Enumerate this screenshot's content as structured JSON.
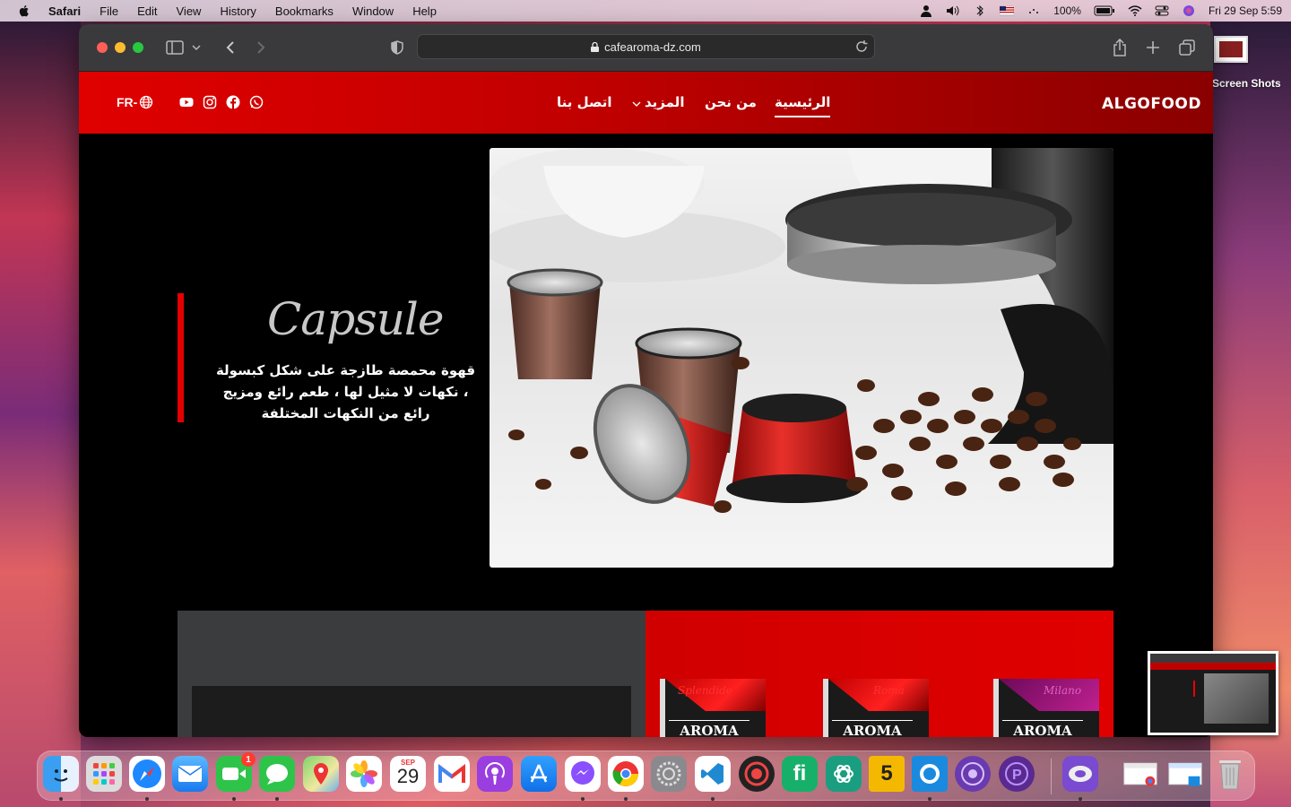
{
  "menubar": {
    "app_name": "Safari",
    "items": [
      "File",
      "Edit",
      "View",
      "History",
      "Bookmarks",
      "Window",
      "Help"
    ],
    "battery": "100%",
    "datetime": "Fri 29 Sep  5:59"
  },
  "desktop": {
    "item_label": "Screen Shots"
  },
  "browser": {
    "url": "cafearoma-dz.com"
  },
  "site": {
    "logo": "ALGOFOOD",
    "nav": {
      "home": "الرئيسية",
      "about": "من نحن",
      "more": "المزيد",
      "contact": "اتصل بنا"
    },
    "lang": "FR-",
    "hero": {
      "title": "Capsule",
      "description": "قهوة محمصة طازجة على شكل كبسولة ، نكهات لا مثيل لها ، طعم رائع ومزيج رائع من النكهات المختلفة"
    },
    "products": [
      {
        "name": "Splendide",
        "brand": "AROMA"
      },
      {
        "name": "Roma",
        "brand": "AROMA"
      },
      {
        "name": "Milano",
        "brand": "AROMA"
      }
    ]
  },
  "dock": {
    "calendar_month": "SEP",
    "calendar_day": "29",
    "facetime_badge": "1"
  },
  "colors": {
    "brand_red": "#e00000",
    "dark": "#000000"
  }
}
